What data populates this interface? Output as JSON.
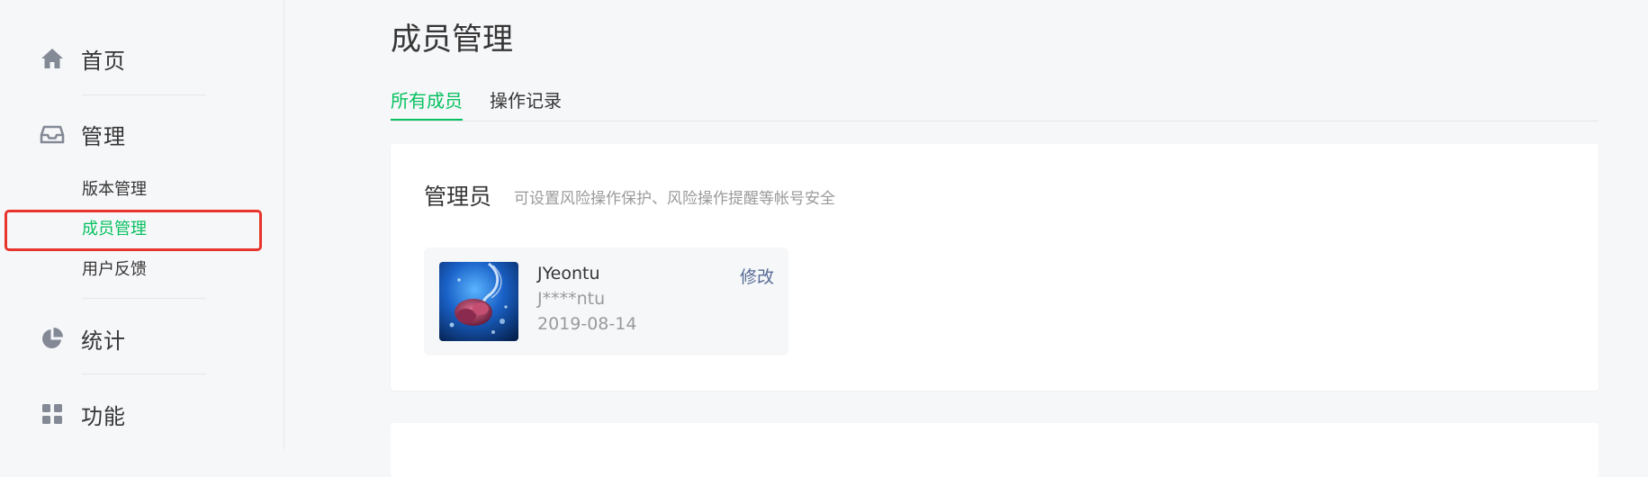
{
  "sidebar": {
    "home": {
      "label": "首页",
      "icon": "home-icon"
    },
    "manage": {
      "label": "管理",
      "icon": "inbox-icon",
      "items": [
        {
          "label": "版本管理"
        },
        {
          "label": "成员管理",
          "active": true
        },
        {
          "label": "用户反馈"
        }
      ]
    },
    "stats": {
      "label": "统计",
      "icon": "pie-chart-icon"
    },
    "features": {
      "label": "功能",
      "icon": "grid-icon"
    }
  },
  "page": {
    "title": "成员管理",
    "tabs": [
      {
        "label": "所有成员",
        "active": true
      },
      {
        "label": "操作记录"
      }
    ]
  },
  "admin_section": {
    "title": "管理员",
    "description": "可设置风险操作保护、风险操作提醒等帐号安全",
    "member": {
      "name": "JYeontu",
      "account": "J****ntu",
      "date": "2019-08-14",
      "edit_label": "修改"
    }
  },
  "colors": {
    "accent": "#07c160",
    "link": "#576b95",
    "highlight": "#e8342d",
    "muted": "#9a9a9a"
  }
}
